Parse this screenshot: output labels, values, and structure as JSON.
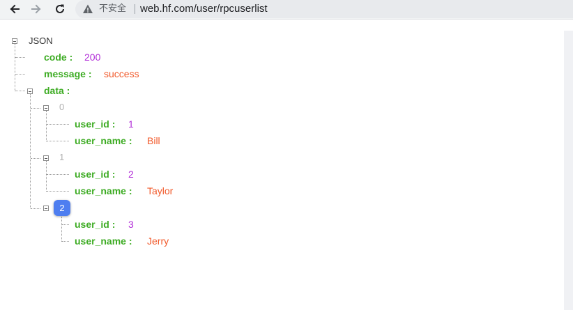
{
  "browser": {
    "security_label": "不安全",
    "url": "web.hf.com/user/rpcuserlist",
    "icons": {
      "back": "arrow-left-icon",
      "forward": "arrow-right-icon",
      "reload": "reload-icon",
      "warning": "warning-icon"
    }
  },
  "json_view": {
    "root_label": "JSON",
    "code": {
      "key": "code :",
      "value": "200"
    },
    "message": {
      "key": "message :",
      "value": "success"
    },
    "data": {
      "key": "data :"
    },
    "items": [
      {
        "index": "0",
        "user_id_key": "user_id :",
        "user_id": "1",
        "user_name_key": "user_name :",
        "user_name": "Bill"
      },
      {
        "index": "1",
        "user_id_key": "user_id :",
        "user_id": "2",
        "user_name_key": "user_name :",
        "user_name": "Taylor"
      },
      {
        "index": "2",
        "user_id_key": "user_id :",
        "user_id": "3",
        "user_name_key": "user_name :",
        "user_name": "Jerry"
      }
    ],
    "colors": {
      "key": "#3eac24",
      "number": "#b22fd8",
      "string": "#f1592a",
      "active_index_bg": "#4e7ef0"
    }
  }
}
